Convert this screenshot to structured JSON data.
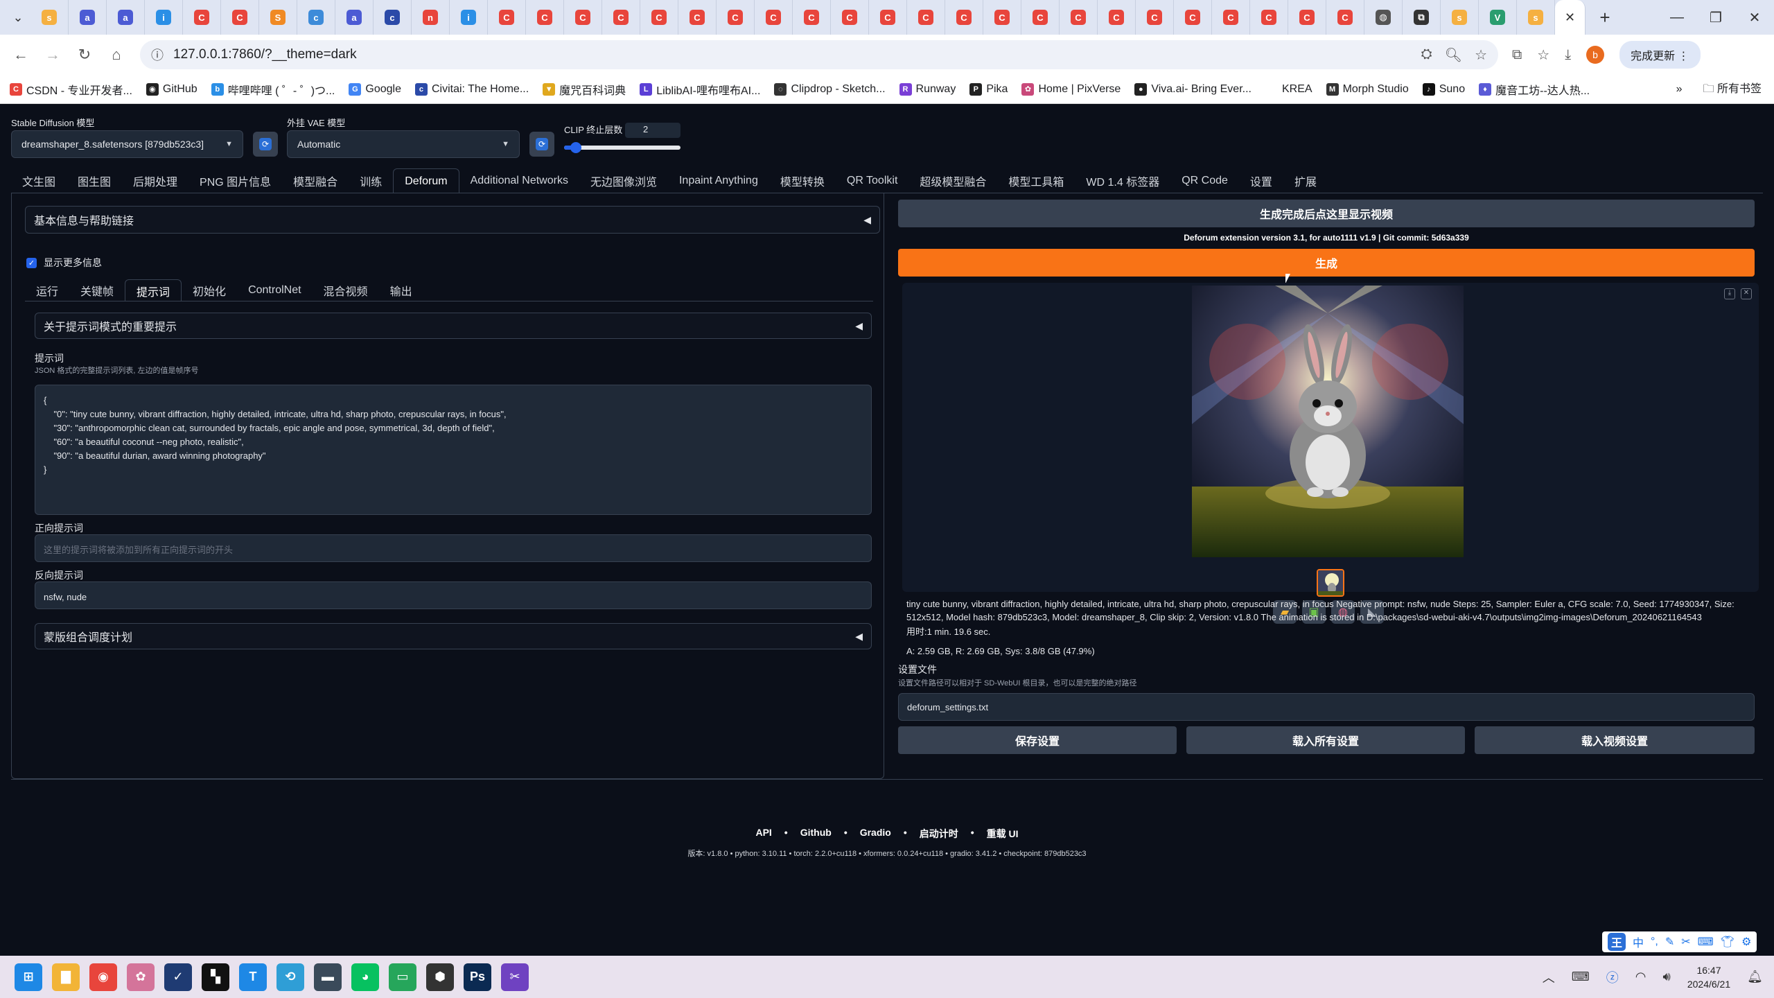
{
  "browser": {
    "tabs": [
      {
        "icon": "s",
        "color": "#f5b041"
      },
      {
        "icon": "a",
        "color": "#4c5bd4"
      },
      {
        "icon": "a",
        "color": "#4c5bd4"
      },
      {
        "icon": "i",
        "color": "#2b8fe6"
      },
      {
        "icon": "C",
        "color": "#e8453c"
      },
      {
        "icon": "C",
        "color": "#e8453c"
      },
      {
        "icon": "S",
        "color": "#f08a24"
      },
      {
        "icon": "c",
        "color": "#3d8bd9"
      },
      {
        "icon": "a",
        "color": "#4c5bd4"
      },
      {
        "icon": "c",
        "color": "#2b4aa8"
      },
      {
        "icon": "n",
        "color": "#e8453c"
      },
      {
        "icon": "i",
        "color": "#2b8fe6"
      },
      {
        "icon": "C",
        "color": "#e8453c"
      },
      {
        "icon": "C",
        "color": "#e8453c"
      },
      {
        "icon": "C",
        "color": "#e8453c"
      },
      {
        "icon": "C",
        "color": "#e8453c"
      },
      {
        "icon": "C",
        "color": "#e8453c"
      },
      {
        "icon": "C",
        "color": "#e8453c"
      },
      {
        "icon": "C",
        "color": "#e8453c"
      },
      {
        "icon": "C",
        "color": "#e8453c"
      },
      {
        "icon": "C",
        "color": "#e8453c"
      },
      {
        "icon": "C",
        "color": "#e8453c"
      },
      {
        "icon": "C",
        "color": "#e8453c"
      },
      {
        "icon": "C",
        "color": "#e8453c"
      },
      {
        "icon": "C",
        "color": "#e8453c"
      },
      {
        "icon": "C",
        "color": "#e8453c"
      },
      {
        "icon": "C",
        "color": "#e8453c"
      },
      {
        "icon": "C",
        "color": "#e8453c"
      },
      {
        "icon": "C",
        "color": "#e8453c"
      },
      {
        "icon": "C",
        "color": "#e8453c"
      },
      {
        "icon": "C",
        "color": "#e8453c"
      },
      {
        "icon": "C",
        "color": "#e8453c"
      },
      {
        "icon": "C",
        "color": "#e8453c"
      },
      {
        "icon": "C",
        "color": "#e8453c"
      },
      {
        "icon": "C",
        "color": "#e8453c"
      },
      {
        "icon": "◍",
        "color": "#555"
      },
      {
        "icon": "⧉",
        "color": "#333"
      },
      {
        "icon": "s",
        "color": "#f5b041"
      },
      {
        "icon": "V",
        "color": "#2a9d6f"
      },
      {
        "icon": "s",
        "color": "#f5b041"
      }
    ],
    "url": "127.0.0.1:7860/?__theme=dark",
    "update_label": "完成更新",
    "avatar_letter": "b",
    "bookmarks": [
      {
        "label": "CSDN - 专业开发者...",
        "icon": "C",
        "color": "#e8453c"
      },
      {
        "label": "GitHub",
        "icon": "◉",
        "color": "#222"
      },
      {
        "label": "哔哩哔哩 ( ゜- ゜)つ...",
        "icon": "b",
        "color": "#2b8fe6"
      },
      {
        "label": "Google",
        "icon": "G",
        "color": "#4285f4"
      },
      {
        "label": "Civitai: The Home...",
        "icon": "c",
        "color": "#2b4aa8"
      },
      {
        "label": "魔咒百科词典",
        "icon": "▼",
        "color": "#e0a81e"
      },
      {
        "label": "LiblibAI-哩布哩布AI...",
        "icon": "L",
        "color": "#5b3fd6"
      },
      {
        "label": "Clipdrop - Sketch...",
        "icon": "◌",
        "color": "#333"
      },
      {
        "label": "Runway",
        "icon": "R",
        "color": "#7a3fd6"
      },
      {
        "label": "Pika",
        "icon": "P",
        "color": "#222"
      },
      {
        "label": "Home | PixVerse",
        "icon": "✿",
        "color": "#c9497a"
      },
      {
        "label": "Viva.ai- Bring Ever...",
        "icon": "●",
        "color": "#222"
      },
      {
        "label": "KREA",
        "icon": "",
        "color": "#fff"
      },
      {
        "label": "Morph Studio",
        "icon": "M",
        "color": "#333"
      },
      {
        "label": "Suno",
        "icon": "♪",
        "color": "#111"
      },
      {
        "label": "魔音工坊--达人热...",
        "icon": "♦",
        "color": "#5a5ad6"
      }
    ],
    "all_bookmarks": "所有书签"
  },
  "webui": {
    "sd_model_label": "Stable Diffusion 模型",
    "sd_model_value": "dreamshaper_8.safetensors [879db523c3]",
    "vae_label": "外挂 VAE 模型",
    "vae_value": "Automatic",
    "clip_label": "CLIP 终止层数",
    "clip_value": "2",
    "clip_slider_fraction": 0.1,
    "main_tabs": [
      "文生图",
      "图生图",
      "后期处理",
      "PNG 图片信息",
      "模型融合",
      "训练",
      "Deforum",
      "Additional Networks",
      "无边图像浏览",
      "Inpaint Anything",
      "模型转换",
      "QR Toolkit",
      "超级模型融合",
      "模型工具箱",
      "WD 1.4 标签器",
      "QR Code",
      "设置",
      "扩展"
    ],
    "active_main_tab": 6,
    "info_accordion": "基本信息与帮助链接",
    "show_more_info": "显示更多信息",
    "sub_tabs": [
      "运行",
      "关键帧",
      "提示词",
      "初始化",
      "ControlNet",
      "混合视频",
      "输出"
    ],
    "active_sub_tab": 2,
    "prompt_notice": "关于提示词模式的重要提示",
    "prompts_label": "提示词",
    "prompts_desc": "JSON 格式的完整提示词列表, 左边的值是帧序号",
    "prompts_value": "{\n    \"0\": \"tiny cute bunny, vibrant diffraction, highly detailed, intricate, ultra hd, sharp photo, crepuscular rays, in focus\",\n    \"30\": \"anthropomorphic clean cat, surrounded by fractals, epic angle and pose, symmetrical, 3d, depth of field\",\n    \"60\": \"a beautiful coconut --neg photo, realistic\",\n    \"90\": \"a beautiful durian, award winning photography\"\n}",
    "positive_label": "正向提示词",
    "positive_placeholder": "这里的提示词将被添加到所有正向提示词的开头",
    "negative_label": "反向提示词",
    "negative_value": "nsfw, nude",
    "mask_schedule": "蒙版组合调度计划",
    "video_header": "生成完成后点这里显示视频",
    "version_line": "Deforum extension version 3.1, for auto1111 v1.9 | Git commit: 5d63a339",
    "generate_label": "生成",
    "gen_info": "tiny cute bunny, vibrant diffraction, highly detailed, intricate, ultra hd, sharp photo, crepuscular rays, in focus Negative prompt: nsfw, nude Steps: 25, Sampler: Euler a, CFG scale: 7.0, Seed: 1774930347, Size: 512x512, Model hash: 879db523c3, Model: dreamshaper_8, Clip skip: 2, Version: v1.8.0 The animation is stored in D:\\packages\\sd-webui-aki-v4.7\\outputs\\img2img-images\\Deforum_20240621164543",
    "time_used": "用时:1 min. 19.6 sec.",
    "vram": "A: 2.59 GB, R: 2.69 GB, Sys: 3.8/8 GB (47.9%)",
    "settings_file_label": "设置文件",
    "settings_file_desc": "设置文件路径可以相对于 SD-WebUI 根目录，也可以是完整的绝对路径",
    "settings_file_value": "deforum_settings.txt",
    "save_settings": "保存设置",
    "load_all_settings": "载入所有设置",
    "load_video_settings": "载入视频设置",
    "footer_links": [
      "API",
      "Github",
      "Gradio",
      "启动计时",
      "重载 UI"
    ],
    "footer_version": "版本: v1.8.0  •  python: 3.10.11  •  torch: 2.2.0+cu118  •  xformers: 0.0.24+cu118  •  gradio: 3.41.2  •  checkpoint: 879db523c3"
  },
  "taskbar": {
    "apps": [
      {
        "icon": "⊞",
        "color": "#1e88e5"
      },
      {
        "icon": "▇",
        "color": "#f2b437"
      },
      {
        "icon": "◉",
        "color": "#e8453c"
      },
      {
        "icon": "✿",
        "color": "#d4749a"
      },
      {
        "icon": "✓",
        "color": "#1f3b73"
      },
      {
        "icon": "▚",
        "color": "#111"
      },
      {
        "icon": "T",
        "color": "#1e88e5"
      },
      {
        "icon": "⟲",
        "color": "#2f9ed6"
      },
      {
        "icon": "▬",
        "color": "#3a4a5a"
      },
      {
        "icon": "◕",
        "color": "#07c160"
      },
      {
        "icon": "▭",
        "color": "#26a65b"
      },
      {
        "icon": "⬢",
        "color": "#333"
      },
      {
        "icon": "Ps",
        "color": "#0b2a52"
      },
      {
        "icon": "✂",
        "color": "#6f42c1"
      }
    ],
    "time": "16:47",
    "date": "2024/6/21"
  }
}
